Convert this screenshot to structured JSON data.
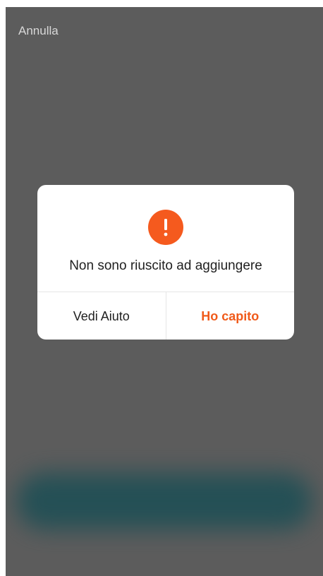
{
  "header": {
    "cancel_label": "Annulla"
  },
  "dialog": {
    "icon": "exclamation-alert-icon",
    "message": "Non sono riuscito ad aggiungere",
    "secondary_label": "Vedi Aiuto",
    "primary_label": "Ho capito"
  },
  "colors": {
    "accent": "#f55a1e",
    "overlay": "#5c5c5c",
    "blurred_background": "#1f4f55"
  }
}
